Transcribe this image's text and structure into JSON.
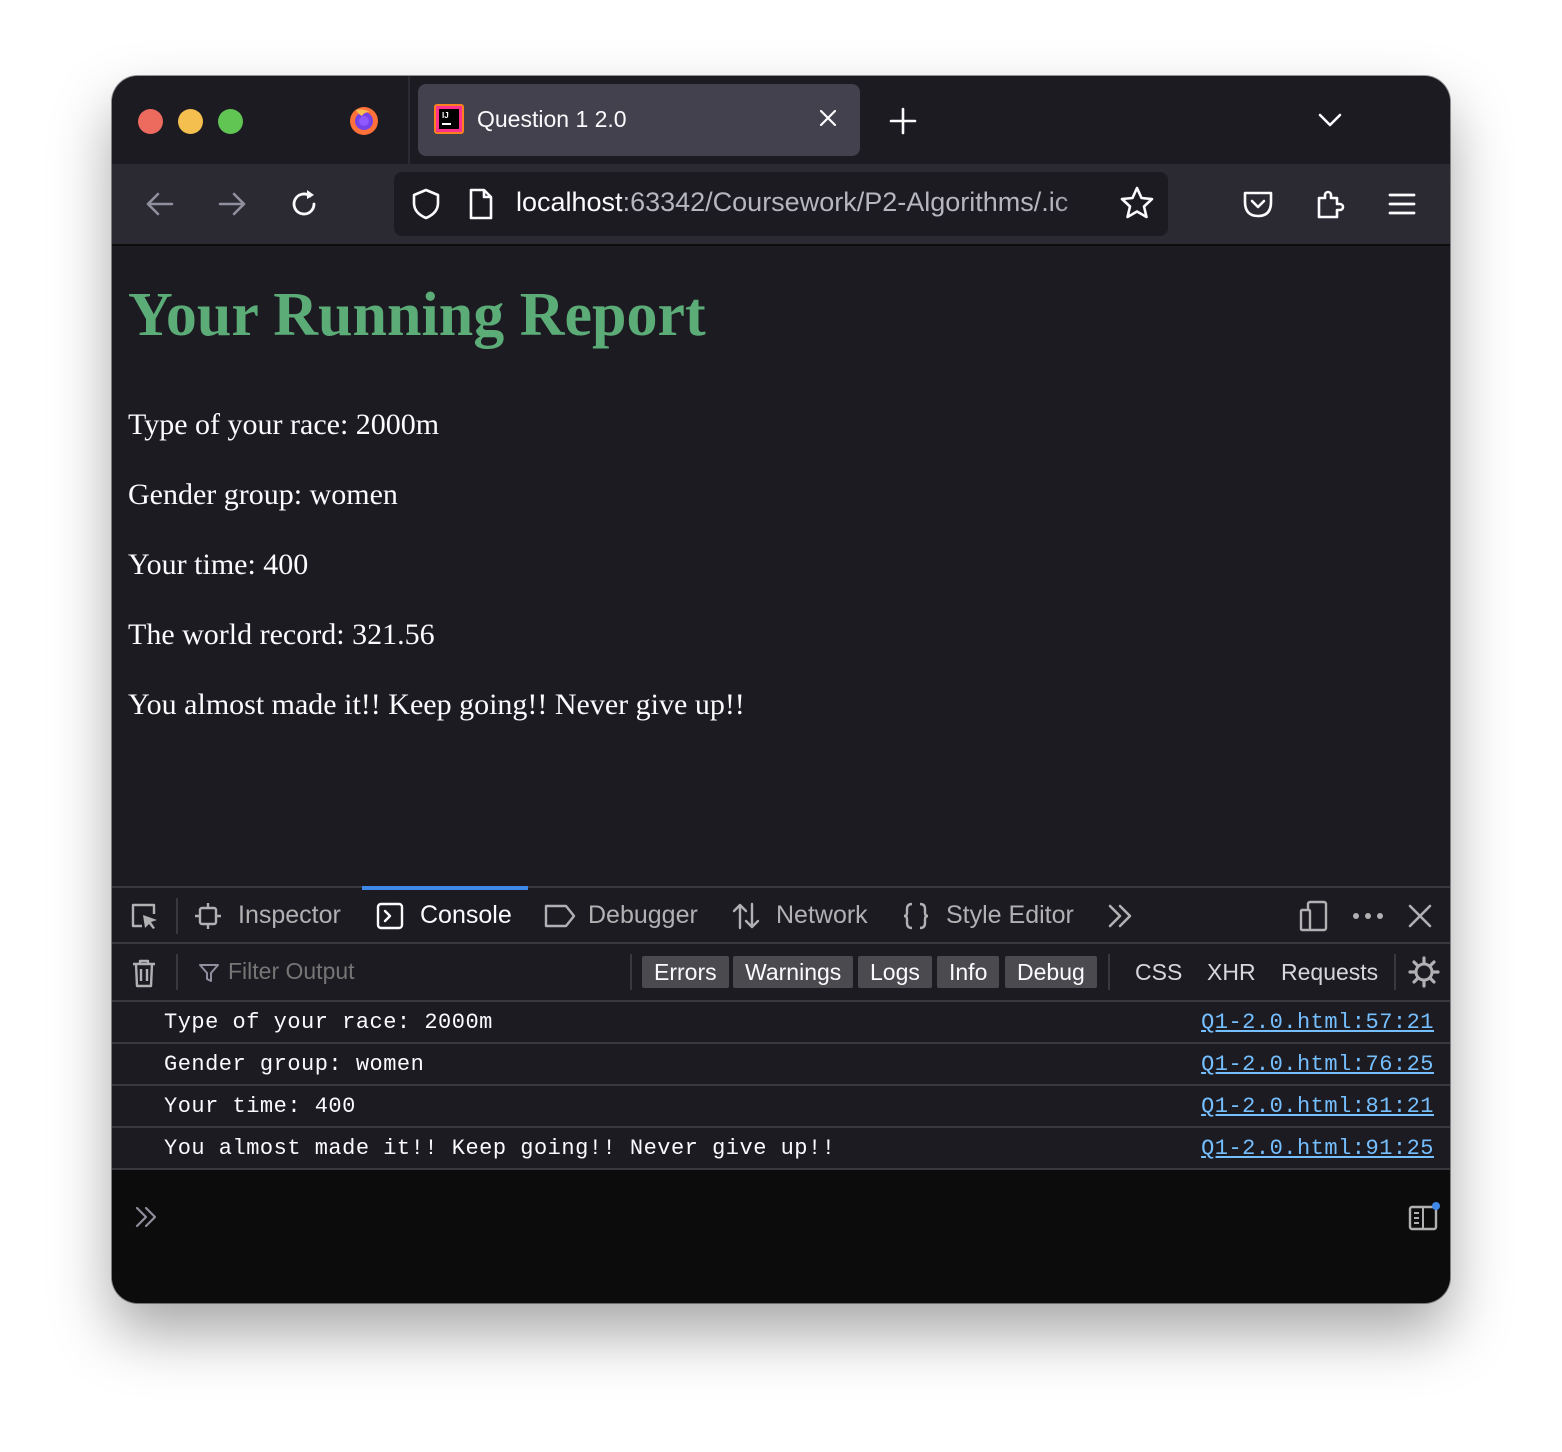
{
  "browser": {
    "tab": {
      "title": "Question 1 2.0"
    },
    "url": {
      "host": "localhost",
      "rest": ":63342/Coursework/P2-Algorithms/.ic"
    }
  },
  "page": {
    "heading": "Your Running Report",
    "paragraphs": [
      "Type of your race: 2000m",
      "Gender group: women",
      "Your time: 400",
      "The world record: 321.56",
      "You almost made it!! Keep going!! Never give up!!"
    ],
    "heading_color": "#5cac78"
  },
  "devtools": {
    "tabs": [
      {
        "label": "Inspector"
      },
      {
        "label": "Console"
      },
      {
        "label": "Debugger"
      },
      {
        "label": "Network"
      },
      {
        "label": "Style Editor"
      }
    ],
    "selected_tab": "Console",
    "filter_placeholder": "Filter Output",
    "level_filters": [
      "Errors",
      "Warnings",
      "Logs",
      "Info",
      "Debug"
    ],
    "type_filters": [
      "CSS",
      "XHR",
      "Requests"
    ],
    "logs": [
      {
        "message": "Type of your race: 2000m",
        "source": "Q1-2.0.html:57:21"
      },
      {
        "message": "Gender group: women",
        "source": "Q1-2.0.html:76:25"
      },
      {
        "message": "Your time: 400",
        "source": "Q1-2.0.html:81:21"
      },
      {
        "message": "You almost made it!! Keep going!! Never give up!!",
        "source": "Q1-2.0.html:91:25"
      }
    ]
  }
}
